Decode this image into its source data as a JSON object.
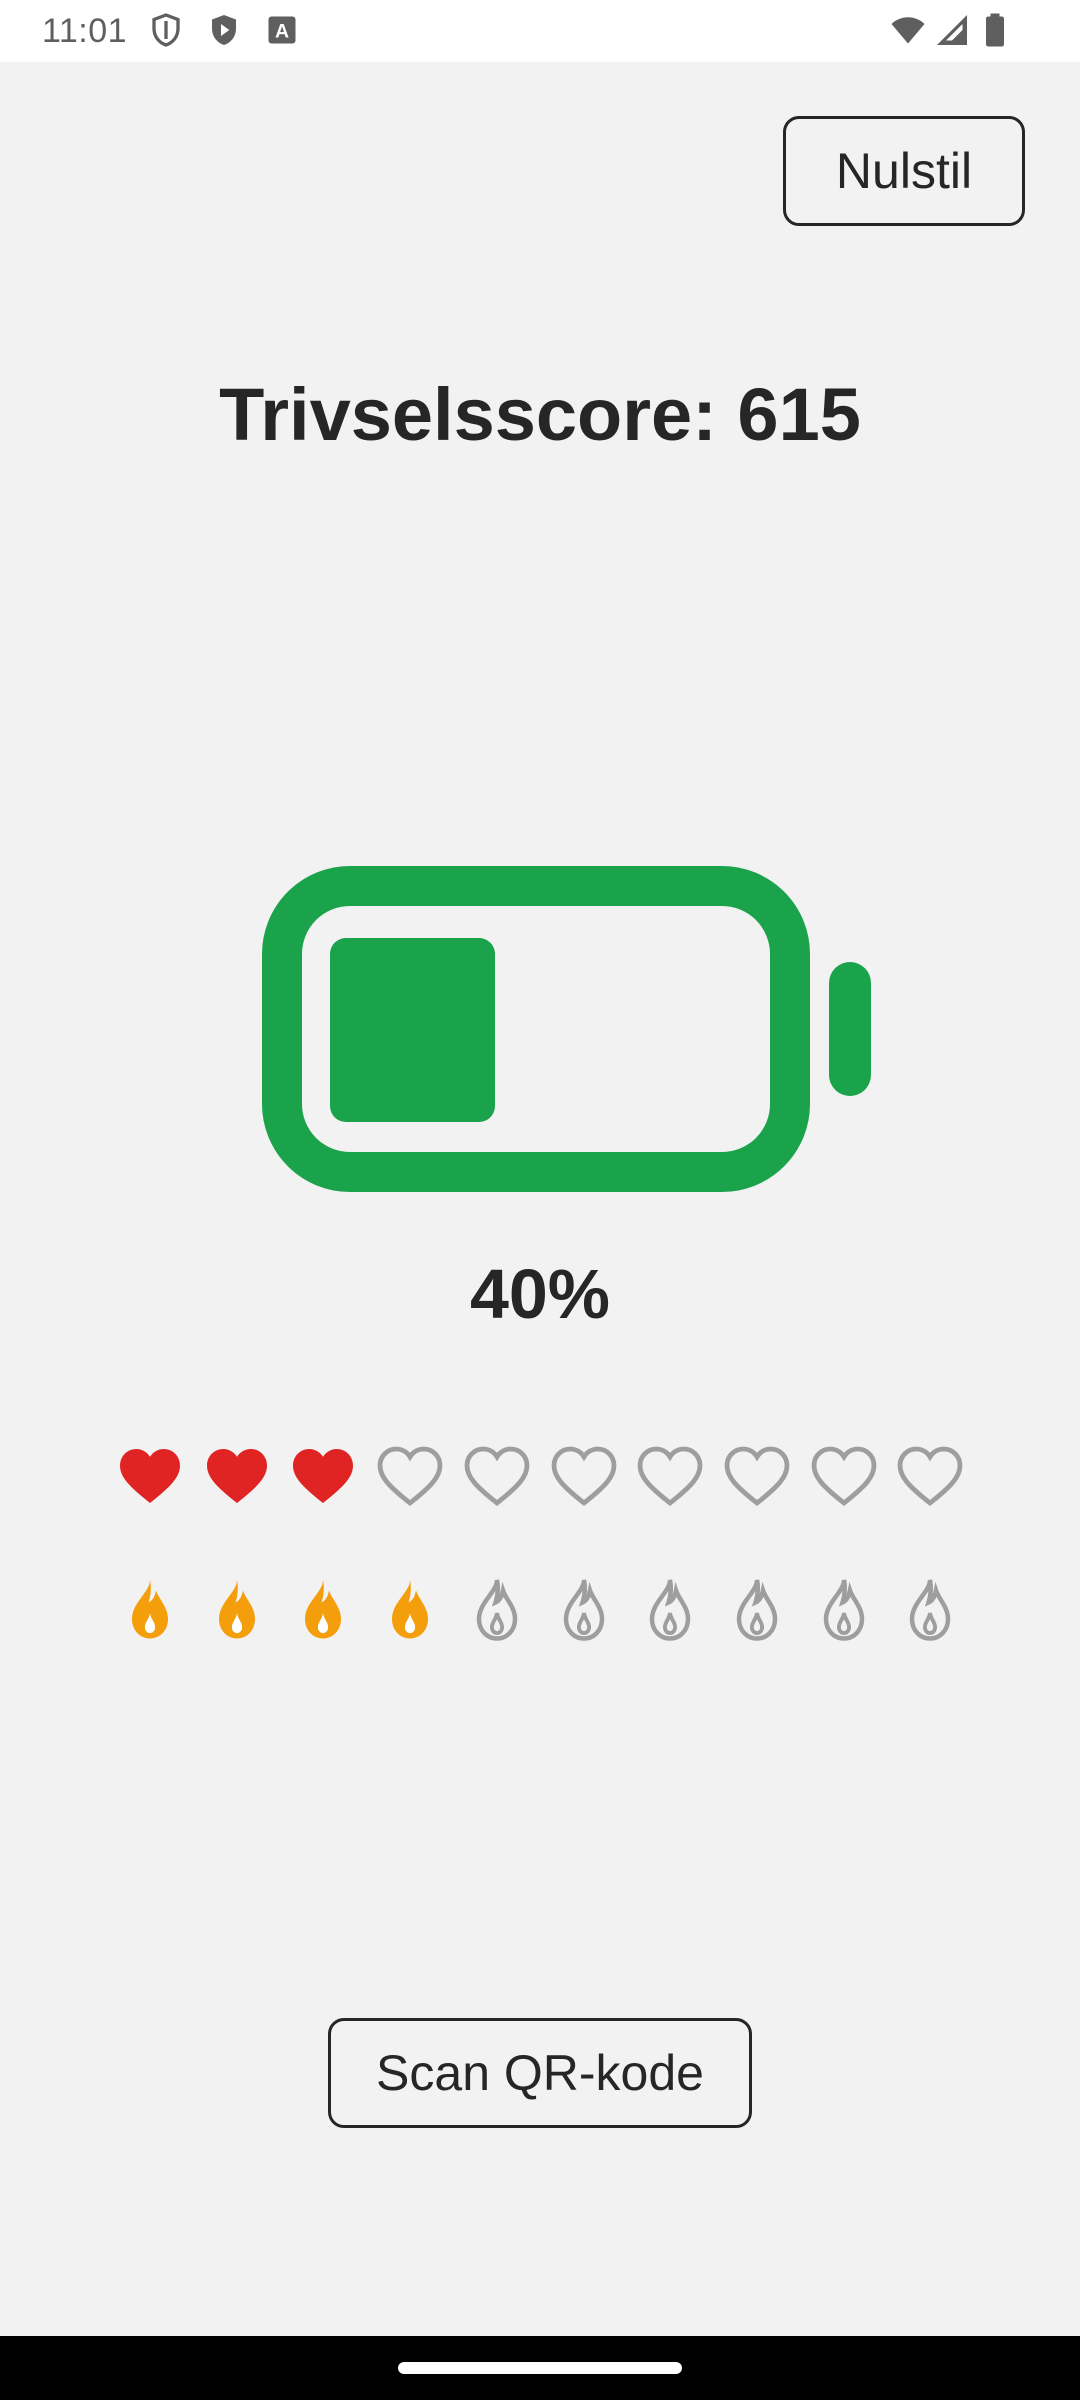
{
  "status_bar": {
    "time": "11:01",
    "left_icons": [
      "shield-outline-icon",
      "play-shield-icon",
      "font-a-icon"
    ],
    "right_icons": [
      "wifi-icon",
      "cellular-signal-icon",
      "battery-full-icon"
    ]
  },
  "header": {
    "reset_label": "Nulstil"
  },
  "score": {
    "title": "Trivselsscore: 615"
  },
  "battery": {
    "level_percent": 40,
    "percent_label": "40%",
    "color": "#1aa34a"
  },
  "hearts": {
    "filled": 3,
    "total": 10,
    "filled_color": "#e02424",
    "empty_color": "#9e9e9e"
  },
  "flames": {
    "filled": 4,
    "total": 10,
    "filled_color": "#f59e0b",
    "empty_color": "#9e9e9e"
  },
  "actions": {
    "scan_label": "Scan QR-kode"
  }
}
